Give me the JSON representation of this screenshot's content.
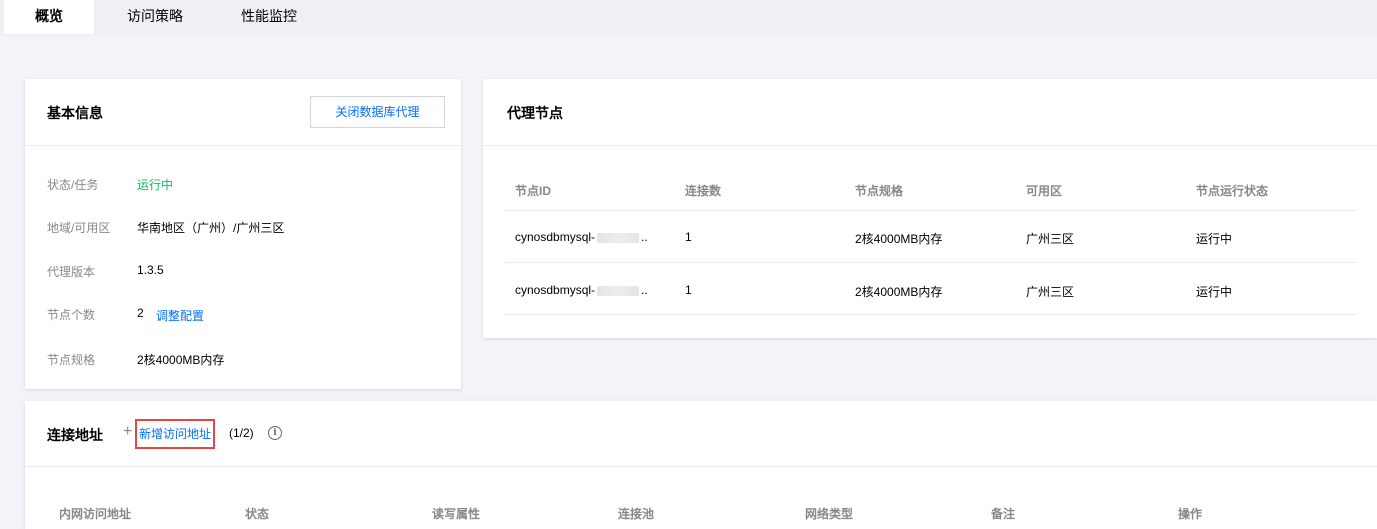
{
  "tabs": [
    {
      "label": "概览",
      "active": true
    },
    {
      "label": "访问策略",
      "active": false
    },
    {
      "label": "性能监控",
      "active": false
    }
  ],
  "basic_info": {
    "title": "基本信息",
    "close_button": "关闭数据库代理",
    "fields": [
      {
        "label": "状态/任务",
        "value": "运行中"
      },
      {
        "label": "地域/可用区",
        "value": "华南地区（广州）/广州三区"
      },
      {
        "label": "代理版本",
        "value": "1.3.5"
      },
      {
        "label": "节点个数",
        "value": "2",
        "action": "调整配置"
      },
      {
        "label": "节点规格",
        "value": "2核4000MB内存"
      }
    ]
  },
  "proxy_nodes": {
    "title": "代理节点",
    "columns": [
      "节点ID",
      "连接数",
      "节点规格",
      "可用区",
      "节点运行状态"
    ],
    "rows": [
      {
        "id": "cynosdbmysql-",
        "connections": "1",
        "spec": "2核4000MB内存",
        "zone": "广州三区",
        "status": "运行中"
      },
      {
        "id": "cynosdbmysql-",
        "connections": "1",
        "spec": "2核4000MB内存",
        "zone": "广州三区",
        "status": "运行中"
      }
    ],
    "ellipsis": ".."
  },
  "connection": {
    "title": "连接地址",
    "add_link": "新增访问地址",
    "count": "(1/2)",
    "info_glyph": "i",
    "columns": [
      "内网访问地址",
      "状态",
      "读写属性",
      "连接池",
      "网络类型",
      "备注",
      "操作"
    ]
  },
  "colors": {
    "accent": "#006eff",
    "running": "#0abf5b",
    "highlight_border": "#e54545"
  }
}
